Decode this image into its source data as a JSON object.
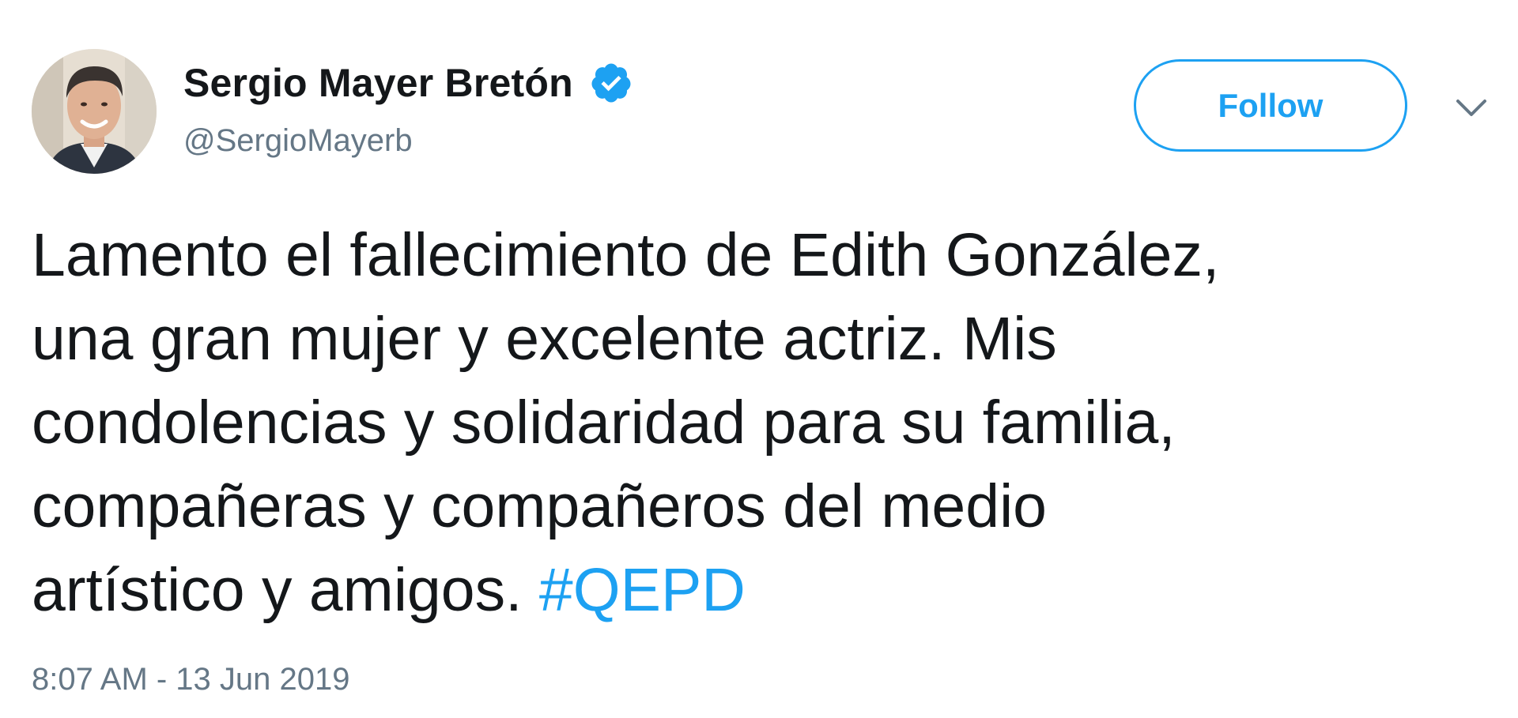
{
  "author": {
    "display_name": "Sergio Mayer Bretón",
    "handle": "@SergioMayerb",
    "verified_icon": "verified-badge-icon",
    "avatar_icon": "avatar-photo"
  },
  "actions": {
    "follow_label": "Follow",
    "more_icon": "chevron-down-icon"
  },
  "tweet": {
    "lines": [
      "Lamento el fallecimiento de Edith González,",
      "una gran mujer y excelente actriz. Mis",
      "condolencias y solidaridad para su familia,",
      "compañeras y compañeros del medio"
    ],
    "last_line_text": "artístico y amigos. ",
    "hashtag": "#QEPD",
    "timestamp": "8:07 AM - 13 Jun 2019"
  },
  "colors": {
    "accent": "#1da1f2",
    "text": "#14171a",
    "muted": "#657786"
  }
}
